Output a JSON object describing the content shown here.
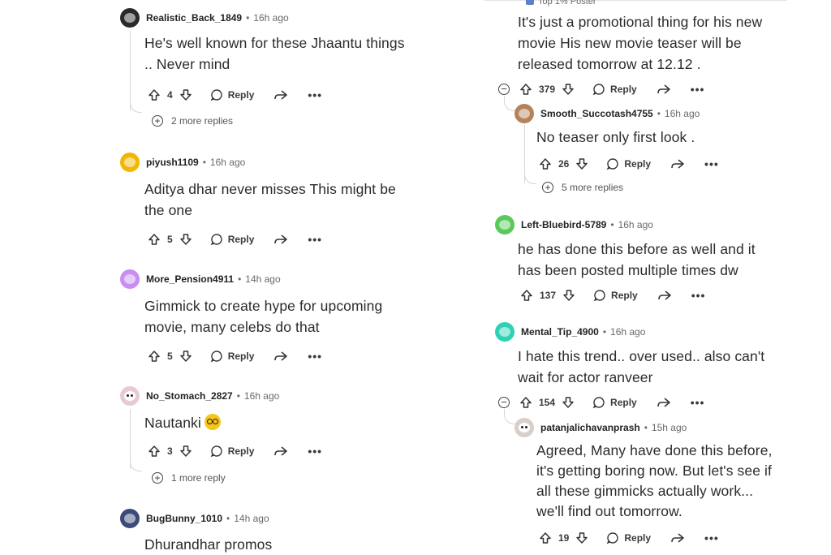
{
  "ui": {
    "reply_label": "Reply",
    "more_glyph": "•••",
    "dot": "•"
  },
  "left": [
    {
      "user": "Realistic_Back_1849",
      "time": "16h ago",
      "lines": [
        "He's well known for these Jhaantu things",
        ".. Never mind"
      ],
      "score": "4",
      "more_replies": "2 more replies",
      "avatar": "#2a2a2a"
    },
    {
      "user": "piyush1109",
      "time": "16h ago",
      "lines": [
        "Aditya dhar never misses This might be",
        "the one"
      ],
      "score": "5",
      "avatar": "#f2b705"
    },
    {
      "user": "More_Pension4911",
      "time": "14h ago",
      "lines": [
        "Gimmick to create hype for upcoming",
        "movie, many celebs do that"
      ],
      "score": "5",
      "avatar": "#c98ef0"
    },
    {
      "user": "No_Stomach_2827",
      "time": "16h ago",
      "lines": [
        "Nautanki"
      ],
      "emoji": "nerd-face-emoji",
      "score": "3",
      "more_replies": "1 more reply",
      "avatar": "#e8c9d6"
    },
    {
      "user": "BugBunny_1010",
      "time": "14h ago",
      "lines": [
        "Dhurandhar promos"
      ],
      "avatar": "#3b4a7a"
    }
  ],
  "right": {
    "top_badge": "Top 1% Poster",
    "op": {
      "lines": [
        "It's just a promotional thing for his new",
        "movie His new movie teaser will be",
        "released tomorrow at 12.12 ."
      ],
      "score": "379"
    },
    "reply1": {
      "user": "Smooth_Succotash4755",
      "time": "16h ago",
      "lines": [
        "No teaser only first look ."
      ],
      "score": "26",
      "more_replies": "5 more replies",
      "avatar": "#b5835a"
    },
    "c2": {
      "user": "Left-Bluebird-5789",
      "time": "16h ago",
      "lines": [
        "he has done this before as well and it",
        "has been posted multiple times dw"
      ],
      "score": "137",
      "avatar": "#5bc85b"
    },
    "c3": {
      "user": "Mental_Tip_4900",
      "time": "16h ago",
      "lines": [
        "I hate this trend.. over used.. also can't",
        "wait for actor ranveer"
      ],
      "score": "154",
      "avatar": "#2fd1b5"
    },
    "reply2": {
      "user": "patanjalichavanprash",
      "time": "15h ago",
      "lines": [
        "Agreed, Many have done this before,",
        "it's getting boring now. But let's see if",
        "all these gimmicks actually work...",
        "we'll find out tomorrow."
      ],
      "score": "19",
      "avatar": "#d9cfc8"
    }
  }
}
